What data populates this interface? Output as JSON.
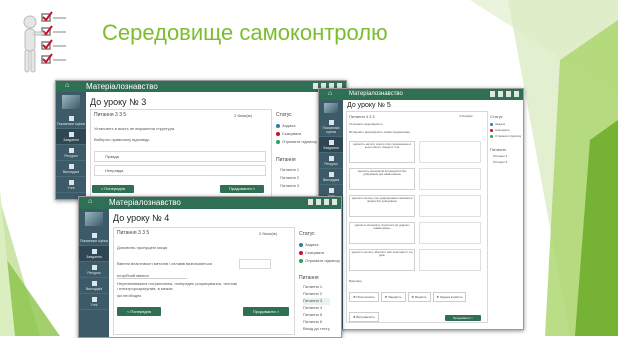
{
  "slide": {
    "title": "Середовище самоконтролю",
    "colors": {
      "accent": "#7cbd2f",
      "app_header": "#2f6f54",
      "sidebar": "#3c5a68"
    }
  },
  "app": {
    "name": "Матеріалознавство",
    "sidebar": [
      {
        "label": "Показники оцінок",
        "icon": "chart-icon"
      },
      {
        "label": "Завдання",
        "icon": "book-icon"
      },
      {
        "label": "Ресурси",
        "icon": "folder-icon"
      },
      {
        "label": "Викладачі",
        "icon": "user-icon"
      },
      {
        "label": "Учні",
        "icon": "users-icon"
      }
    ]
  },
  "win3": {
    "heading": "До уроку № 3",
    "question_label": "Питання 3 3 5",
    "points": "2 бали(ів)",
    "text1": "Установіть в якість не вирішення структура",
    "text2": "Виберіть правильну відповідь",
    "options": [
      "Правда",
      "Неправда"
    ],
    "prev": "< Попередня",
    "next": "Продовжити >",
    "status_title": "Статус",
    "statuses": [
      "Задача",
      "Скасувати",
      "Отримати підписку"
    ],
    "questions_title": "Питання",
    "questions": [
      "Питання 1",
      "Питання 2",
      "Питання 3"
    ]
  },
  "win4": {
    "heading": "До уроку № 4",
    "question_label": "Питання 3 3 5",
    "points": "2 бали(ів)",
    "text1": "Доповніть пропущені місця",
    "fill_text": "Вміння властивості металів і сплавів визначаються",
    "field2": "потрібний вміння",
    "text3": "Неуповноважені потрапляння, попереднє розрахування, теплові і електророзрахунків, в межах",
    "text4": "які необхідно",
    "prev": "< Попередня",
    "next": "Продовжити >",
    "status_title": "Статус",
    "statuses": [
      "Задача",
      "Скасувати",
      "Отримати підписку"
    ],
    "questions_title": "Питання",
    "questions": [
      "Питання 1",
      "Питання 2",
      "Питання 3",
      "Питання 4",
      "Питання 5",
      "Питання 6",
      "Вихід до тесту"
    ]
  },
  "win5": {
    "heading": "До уроку № 5",
    "question_label": "Питання 4 3 5",
    "points": "4 бали(ів)",
    "text1": "Установіть відповідність",
    "text2": "Встановіть відповідність поміж предметами",
    "left_items": [
      "здатність металу чинити опір проникненню в нього іншого твердого тіла",
      "здатність матеріалів витримувати без руйнування дію навантажень",
      "здатність металу при деформуванні змінювати форму без руйнування",
      "здатність матеріалу опиратися дії ударних навантажень",
      "здатність металу зберігати свої властивості під дією"
    ],
    "answers_title": "Відповіді",
    "answers": [
      "Пластичність",
      "Твердість",
      "Міцність",
      "Ударна в'язкість",
      "Витривалість"
    ],
    "next": "Продовжити >",
    "status_title": "Статус",
    "statuses": [
      "Задача",
      "Скасувати",
      "Отримати підписку"
    ],
    "questions_title": "Питання",
    "questions": [
      "Питання 4",
      "Питання 5"
    ]
  }
}
